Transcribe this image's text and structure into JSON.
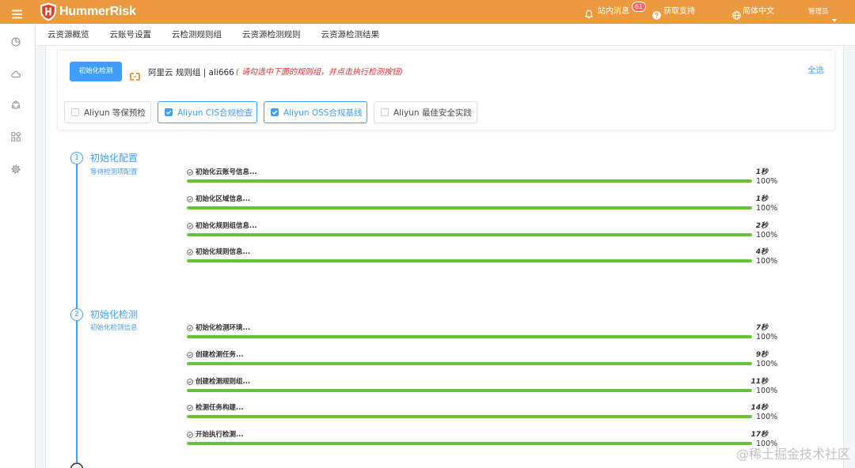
{
  "colors": {
    "header_bg": "#EC9A40",
    "primary": "#409EFF",
    "progress_fill": "#67C23A",
    "hint_red": "#EE2B2B",
    "badge_red": "#F56C6C"
  },
  "header": {
    "menu_icon": "hamburger-menu-icon",
    "logo_icon": "hummerrisk-shield-icon",
    "logo_text": "HummerRisk",
    "messages_icon": "bell-icon",
    "messages_label": "站内消息",
    "messages_badge": "61",
    "support_icon": "question-circle-icon",
    "support_label": "获取支持",
    "language_icon": "globe-icon",
    "language_label": "简体中文",
    "user_label": "管理员"
  },
  "sidebar": {
    "icons": [
      "pie-chart-icon",
      "cloud-icon",
      "cluster-icon",
      "apps-grid-icon",
      "gear-icon"
    ]
  },
  "tabs": [
    {
      "label": "云资源概览"
    },
    {
      "label": "云账号设置"
    },
    {
      "label": "云检测规则组"
    },
    {
      "label": "云资源检测规则"
    },
    {
      "label": "云资源检测结果"
    }
  ],
  "init_card": {
    "button_label": "初始化检测",
    "account_icon": "aliyun-logo-icon",
    "account_text": "阿里云 规则组 | ali666",
    "hint_text": "( 请勾选中下面的规则组，并点击执行检测按钮)",
    "select_all_label": "全选",
    "rule_groups": [
      {
        "label": "Aliyun 等保预检",
        "checked": false
      },
      {
        "label": "Aliyun CIS合规检查",
        "checked": true
      },
      {
        "label": "Aliyun OSS合规基线",
        "checked": true
      },
      {
        "label": "Aliyun 最佳安全实践",
        "checked": false
      }
    ]
  },
  "steps": [
    {
      "number": "1",
      "title": "初始化配置",
      "subtitle": "等待检测项配置",
      "tasks": [
        {
          "label": "初始化云账号信息...",
          "time": "1秒",
          "percent": "100%",
          "progress": 100
        },
        {
          "label": "初始化区域信息...",
          "time": "1秒",
          "percent": "100%",
          "progress": 100
        },
        {
          "label": "初始化规则组信息...",
          "time": "2秒",
          "percent": "100%",
          "progress": 100
        },
        {
          "label": "初始化规则信息...",
          "time": "4秒",
          "percent": "100%",
          "progress": 100
        }
      ]
    },
    {
      "number": "2",
      "title": "初始化检测",
      "subtitle": "初始化检测信息",
      "tasks": [
        {
          "label": "初始化检测环境...",
          "time": "7秒",
          "percent": "100%",
          "progress": 100
        },
        {
          "label": "创建检测任务...",
          "time": "9秒",
          "percent": "100%",
          "progress": 100
        },
        {
          "label": "创建检测规则组...",
          "time": "11秒",
          "percent": "100%",
          "progress": 100
        },
        {
          "label": "检测任务构建...",
          "time": "14秒",
          "percent": "100%",
          "progress": 100
        },
        {
          "label": "开始执行检测...",
          "time": "17秒",
          "percent": "100%",
          "progress": 100
        }
      ]
    }
  ],
  "watermark": "@稀土掘金技术社区"
}
